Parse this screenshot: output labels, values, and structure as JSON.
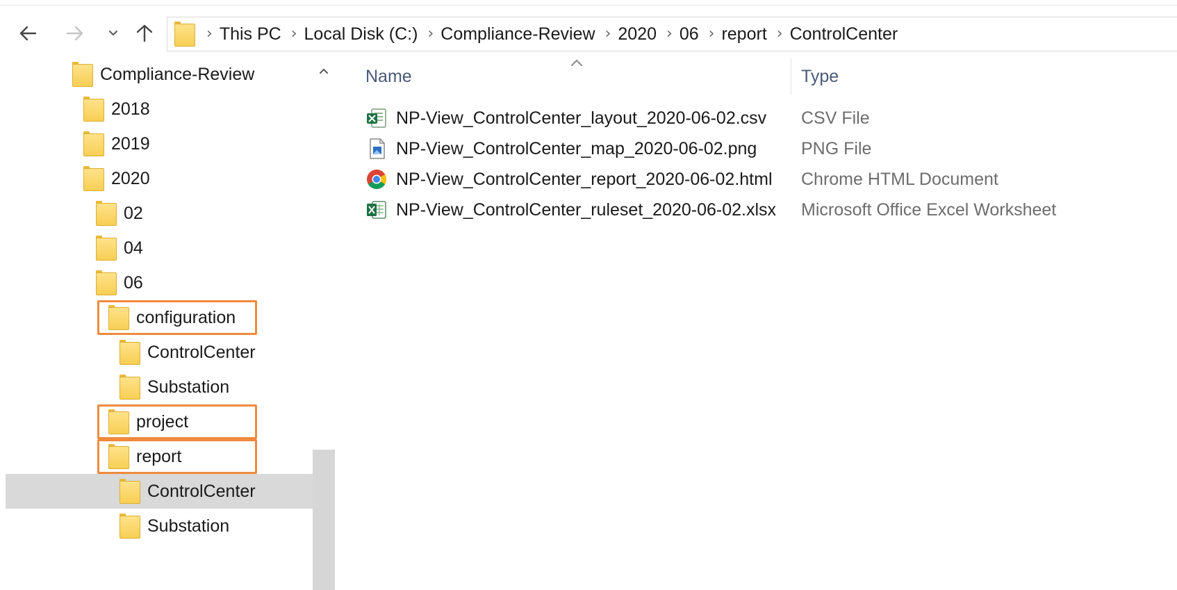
{
  "window": {
    "breadcrumbs": [
      "This PC",
      "Local Disk (C:)",
      "Compliance-Review",
      "2020",
      "06",
      "report",
      "ControlCenter"
    ]
  },
  "nav_tree": [
    {
      "label": "Compliance-Review",
      "depth": 0
    },
    {
      "label": "2018",
      "depth": 1
    },
    {
      "label": "2019",
      "depth": 1
    },
    {
      "label": "2020",
      "depth": 1
    },
    {
      "label": "02",
      "depth": 2
    },
    {
      "label": "04",
      "depth": 2
    },
    {
      "label": "06",
      "depth": 2
    },
    {
      "label": "configuration",
      "depth": 3,
      "highlighted": true
    },
    {
      "label": "ControlCenter",
      "depth": 4
    },
    {
      "label": "Substation",
      "depth": 4
    },
    {
      "label": "project",
      "depth": 3,
      "highlighted": true
    },
    {
      "label": "report",
      "depth": 3,
      "highlighted": true
    },
    {
      "label": "ControlCenter",
      "depth": 4,
      "selected": true
    },
    {
      "label": "Substation",
      "depth": 4
    }
  ],
  "file_list": {
    "columns": {
      "name": "Name",
      "type": "Type"
    },
    "files": [
      {
        "name": "NP-View_ControlCenter_layout_2020-06-02.csv",
        "type": "CSV File",
        "icon": "csv-file-icon"
      },
      {
        "name": "NP-View_ControlCenter_map_2020-06-02.png",
        "type": "PNG File",
        "icon": "image-file-icon"
      },
      {
        "name": "NP-View_ControlCenter_report_2020-06-02.html",
        "type": "Chrome HTML Document",
        "icon": "chrome-icon"
      },
      {
        "name": "NP-View_ControlCenter_ruleset_2020-06-02.xlsx",
        "type": "Microsoft Office Excel Worksheet",
        "icon": "excel-file-icon"
      }
    ]
  },
  "colors": {
    "highlight_box": "#f08a3c",
    "selected_row": "#d9d9d9",
    "folder_yellow": "#f7cf55",
    "column_header": "#4a5a78"
  }
}
